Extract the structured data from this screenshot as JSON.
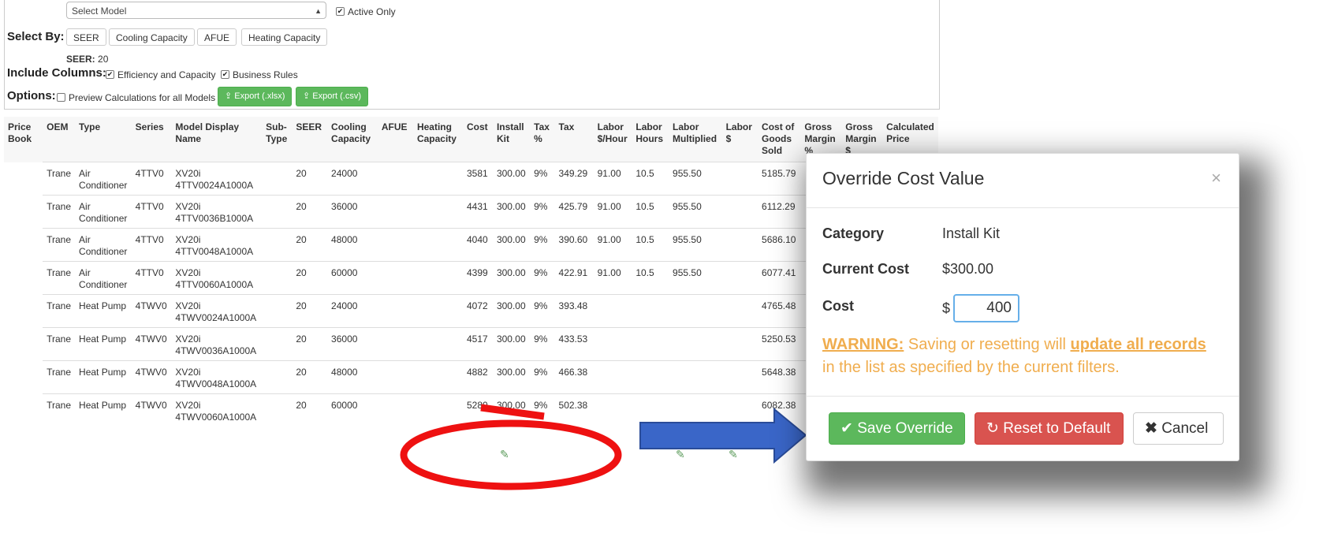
{
  "filters": {
    "model_select": "Select Model",
    "active_only_label": "Active Only",
    "select_by_label": "Select By:",
    "select_by_buttons": [
      "SEER",
      "Cooling Capacity",
      "AFUE",
      "Heating Capacity"
    ],
    "seer_label": "SEER:",
    "seer_value": "20",
    "include_columns_label": "Include Columns:",
    "include_efficiency_label": "Efficiency and Capacity",
    "include_business_label": "Business Rules",
    "options_label": "Options:",
    "preview_label": "Preview Calculations for all Models",
    "export_xlsx": "Export (.xlsx)",
    "export_csv": "Export (.csv)"
  },
  "table": {
    "headers": [
      "Price Book",
      "OEM",
      "Type",
      "Series",
      "Model Display Name",
      "Sub-Type",
      "SEER",
      "Cooling Capacity",
      "AFUE",
      "Heating Capacity",
      "Cost",
      "Install Kit",
      "Tax %",
      "Tax",
      "Labor $/Hour",
      "Labor Hours",
      "Labor Multiplied",
      "Labor $",
      "Cost of Goods Sold",
      "Gross Margin %",
      "Gross Margin $",
      "Calculated Price"
    ],
    "rows": [
      [
        "",
        "Trane",
        "Air Conditioner",
        "4TTV0",
        "XV20i 4TTV0024A1000A",
        "",
        "20",
        "24000",
        "",
        "",
        "3581",
        "300.00",
        "9%",
        "349.29",
        "91.00",
        "10.5",
        "955.50",
        "",
        "5185.79",
        "",
        "",
        ""
      ],
      [
        "",
        "Trane",
        "Air Conditioner",
        "4TTV0",
        "XV20i 4TTV0036B1000A",
        "",
        "20",
        "36000",
        "",
        "",
        "4431",
        "300.00",
        "9%",
        "425.79",
        "91.00",
        "10.5",
        "955.50",
        "",
        "6112.29",
        "",
        "",
        ""
      ],
      [
        "",
        "Trane",
        "Air Conditioner",
        "4TTV0",
        "XV20i 4TTV0048A1000A",
        "",
        "20",
        "48000",
        "",
        "",
        "4040",
        "300.00",
        "9%",
        "390.60",
        "91.00",
        "10.5",
        "955.50",
        "",
        "5686.10",
        "",
        "",
        ""
      ],
      [
        "",
        "Trane",
        "Air Conditioner",
        "4TTV0",
        "XV20i 4TTV0060A1000A",
        "",
        "20",
        "60000",
        "",
        "",
        "4399",
        "300.00",
        "9%",
        "422.91",
        "91.00",
        "10.5",
        "955.50",
        "",
        "6077.41",
        "",
        "",
        ""
      ],
      [
        "",
        "Trane",
        "Heat Pump",
        "4TWV0",
        "XV20i 4TWV0024A1000A",
        "",
        "20",
        "24000",
        "",
        "",
        "4072",
        "300.00",
        "9%",
        "393.48",
        "",
        "",
        "",
        "",
        "4765.48",
        "",
        "",
        ""
      ],
      [
        "",
        "Trane",
        "Heat Pump",
        "4TWV0",
        "XV20i 4TWV0036A1000A",
        "",
        "20",
        "36000",
        "",
        "",
        "4517",
        "300.00",
        "9%",
        "433.53",
        "",
        "",
        "",
        "",
        "5250.53",
        "",
        "",
        ""
      ],
      [
        "",
        "Trane",
        "Heat Pump",
        "4TWV0",
        "XV20i 4TWV0048A1000A",
        "",
        "20",
        "48000",
        "",
        "",
        "4882",
        "300.00",
        "9%",
        "466.38",
        "",
        "",
        "",
        "",
        "5648.38",
        "",
        "",
        ""
      ],
      [
        "",
        "Trane",
        "Heat Pump",
        "4TWV0",
        "XV20i 4TWV0060A1000A",
        "",
        "20",
        "60000",
        "",
        "",
        "5280",
        "300.00",
        "9%",
        "502.38",
        "",
        "",
        "",
        "",
        "6082.38",
        "",
        "",
        ""
      ]
    ]
  },
  "modal": {
    "title": "Override Cost Value",
    "close": "×",
    "category_label": "Category",
    "category_value": "Install Kit",
    "current_cost_label": "Current Cost",
    "current_cost_value": "$300.00",
    "cost_label": "Cost",
    "currency": "$",
    "cost_input": "400",
    "warning_prefix": "WARNING:",
    "warning_mid": " Saving or resetting will ",
    "warning_emph": "update all records",
    "warning_suffix": " in the list as specified by the current filters.",
    "save_button": "Save Override",
    "reset_button": "Reset to Default",
    "cancel_button": "Cancel"
  },
  "colors": {
    "annotation_red": "#ee1111",
    "annotation_arrow": "#3a66c8",
    "warning": "#f0ad4e",
    "save_green": "#5cb85c",
    "reset_red": "#d9534f"
  }
}
